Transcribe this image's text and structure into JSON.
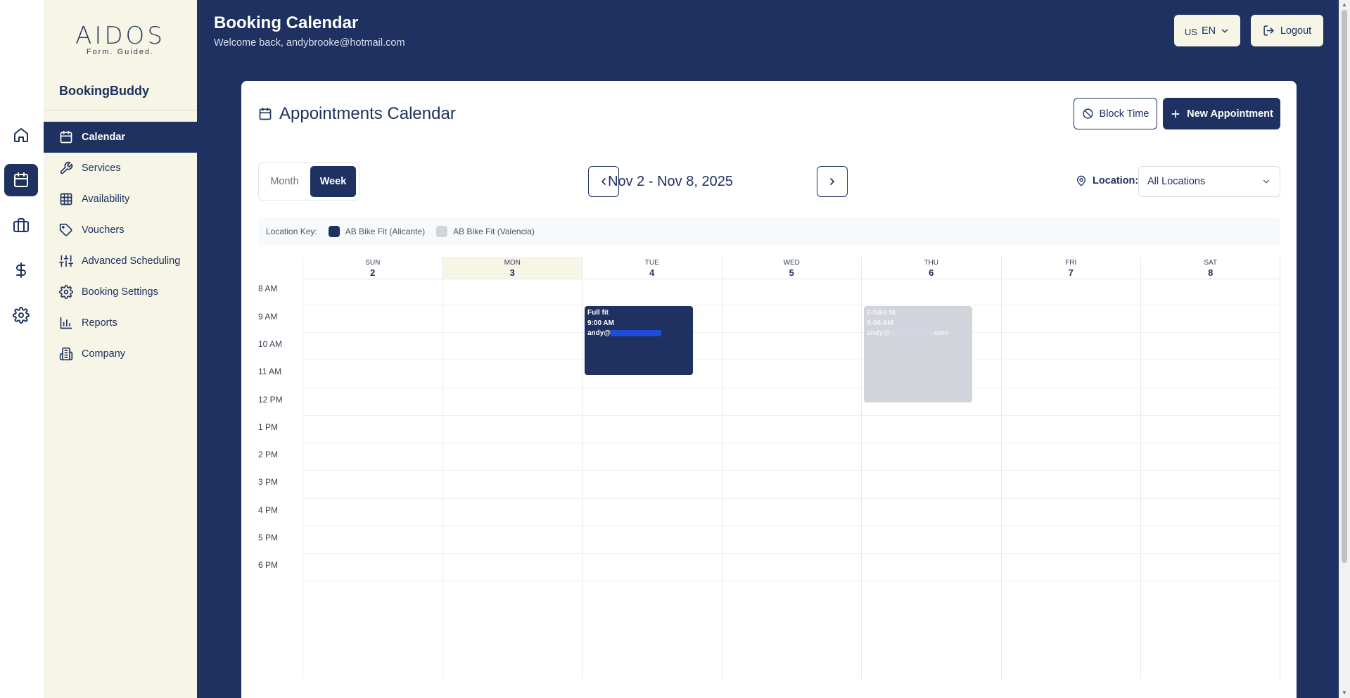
{
  "rail": {
    "items": [
      {
        "icon": "home-icon",
        "active": false
      },
      {
        "icon": "calendar-icon",
        "active": true
      },
      {
        "icon": "briefcase-icon",
        "active": false
      },
      {
        "icon": "dollar-icon",
        "active": false
      },
      {
        "icon": "gear-icon",
        "active": false
      }
    ]
  },
  "sidebar": {
    "logo_main": "AIDOS",
    "logo_sub": "Form. Guided.",
    "brand": "BookingBuddy",
    "items": [
      {
        "label": "Calendar",
        "icon": "calendar-icon",
        "active": true
      },
      {
        "label": "Services",
        "icon": "wrench-icon",
        "active": false
      },
      {
        "label": "Availability",
        "icon": "grid-icon",
        "active": false
      },
      {
        "label": "Vouchers",
        "icon": "tag-icon",
        "active": false
      },
      {
        "label": "Advanced Scheduling",
        "icon": "sliders-icon",
        "active": false
      },
      {
        "label": "Booking Settings",
        "icon": "gear-icon",
        "active": false
      },
      {
        "label": "Reports",
        "icon": "bar-chart-icon",
        "active": false
      },
      {
        "label": "Company",
        "icon": "building-icon",
        "active": false
      }
    ]
  },
  "header": {
    "title": "Booking Calendar",
    "subtitle": "Welcome back, andybrooke@hotmail.com",
    "lang_flag": "US",
    "lang_code": "EN",
    "logout_label": "Logout"
  },
  "calendar": {
    "title": "Appointments Calendar",
    "block_time_label": "Block Time",
    "new_appointment_label": "New Appointment",
    "view_month": "Month",
    "view_week": "Week",
    "active_view": "Week",
    "range_label": "Nov 2 - Nov 8, 2025",
    "location_label": "Location:",
    "location_value": "All Locations",
    "key_label": "Location Key:",
    "locations": [
      {
        "name": "AB Bike Fit (Alicante)",
        "color": "#1e3160"
      },
      {
        "name": "AB Bike Fit (Valencia)",
        "color": "#d1d5db"
      }
    ],
    "days": [
      {
        "name": "SUN",
        "num": "2",
        "today": false
      },
      {
        "name": "MON",
        "num": "3",
        "today": true
      },
      {
        "name": "TUE",
        "num": "4",
        "today": false
      },
      {
        "name": "WED",
        "num": "5",
        "today": false
      },
      {
        "name": "THU",
        "num": "6",
        "today": false
      },
      {
        "name": "FRI",
        "num": "7",
        "today": false
      },
      {
        "name": "SAT",
        "num": "8",
        "today": false
      }
    ],
    "hours": [
      "8 AM",
      "9 AM",
      "10 AM",
      "11 AM",
      "12 PM",
      "1 PM",
      "2 PM",
      "3 PM",
      "4 PM",
      "5 PM",
      "6 PM"
    ],
    "events": [
      {
        "title": "Full fit",
        "time": "9:00 AM",
        "email_prefix": "andy@",
        "email_suffix": "",
        "day": "TUE",
        "location": "AB Bike Fit (Alicante)"
      },
      {
        "title": "2-bike fit",
        "time": "9:00 AM",
        "email_prefix": "andy@",
        "email_suffix": ".com",
        "day": "THU",
        "location": "AB Bike Fit (Valencia)"
      }
    ]
  },
  "colors": {
    "primary": "#1e3160",
    "cream": "#f7f5e6",
    "valencia": "#d1d5db",
    "today_bg": "#f7f5e6"
  }
}
